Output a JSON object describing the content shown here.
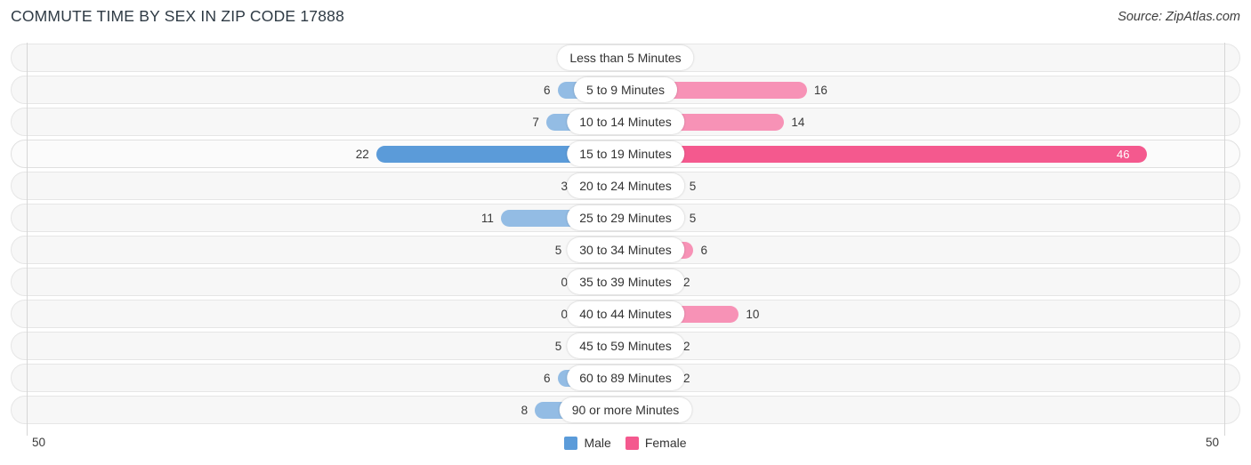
{
  "header": {
    "title": "COMMUTE TIME BY SEX IN ZIP CODE 17888",
    "source": "Source: ZipAtlas.com"
  },
  "legend": {
    "male_label": "Male",
    "female_label": "Female",
    "male_color": "#5b9bd9",
    "female_color": "#f4598e"
  },
  "axis": {
    "left_value": "50",
    "right_value": "50",
    "max": 50
  },
  "colors": {
    "male_light": "#93bce4",
    "male_strong": "#5b9bd9",
    "female_light": "#f792b6",
    "female_strong": "#f4598e",
    "track_bg": "#f7f7f7",
    "track_border": "#e6e6e6"
  },
  "chart_data": {
    "type": "bar",
    "title": "COMMUTE TIME BY SEX IN ZIP CODE 17888",
    "subtitle": "Source: ZipAtlas.com",
    "orientation": "horizontal-diverging",
    "xlabel": "",
    "ylabel": "",
    "xlim": [
      50,
      50
    ],
    "grid": false,
    "legend_position": "bottom-center",
    "categories": [
      "Less than 5 Minutes",
      "5 to 9 Minutes",
      "10 to 14 Minutes",
      "15 to 19 Minutes",
      "20 to 24 Minutes",
      "25 to 29 Minutes",
      "30 to 34 Minutes",
      "35 to 39 Minutes",
      "40 to 44 Minutes",
      "45 to 59 Minutes",
      "60 to 89 Minutes",
      "90 or more Minutes"
    ],
    "series": [
      {
        "name": "Male",
        "direction": "left",
        "color": "#93bce4",
        "values": [
          0,
          6,
          7,
          22,
          3,
          11,
          5,
          0,
          0,
          5,
          6,
          8
        ]
      },
      {
        "name": "Female",
        "direction": "right",
        "color": "#f792b6",
        "values": [
          0,
          16,
          14,
          46,
          5,
          5,
          6,
          2,
          10,
          2,
          2,
          0
        ]
      }
    ],
    "highlight_row_index": 3
  },
  "rows": [
    {
      "label": "Less than 5 Minutes",
      "male": "0",
      "female": "0"
    },
    {
      "label": "5 to 9 Minutes",
      "male": "6",
      "female": "16"
    },
    {
      "label": "10 to 14 Minutes",
      "male": "7",
      "female": "14"
    },
    {
      "label": "15 to 19 Minutes",
      "male": "22",
      "female": "46"
    },
    {
      "label": "20 to 24 Minutes",
      "male": "3",
      "female": "5"
    },
    {
      "label": "25 to 29 Minutes",
      "male": "11",
      "female": "5"
    },
    {
      "label": "30 to 34 Minutes",
      "male": "5",
      "female": "6"
    },
    {
      "label": "35 to 39 Minutes",
      "male": "0",
      "female": "2"
    },
    {
      "label": "40 to 44 Minutes",
      "male": "0",
      "female": "10"
    },
    {
      "label": "45 to 59 Minutes",
      "male": "5",
      "female": "2"
    },
    {
      "label": "60 to 89 Minutes",
      "male": "6",
      "female": "2"
    },
    {
      "label": "90 or more Minutes",
      "male": "8",
      "female": "0"
    }
  ]
}
